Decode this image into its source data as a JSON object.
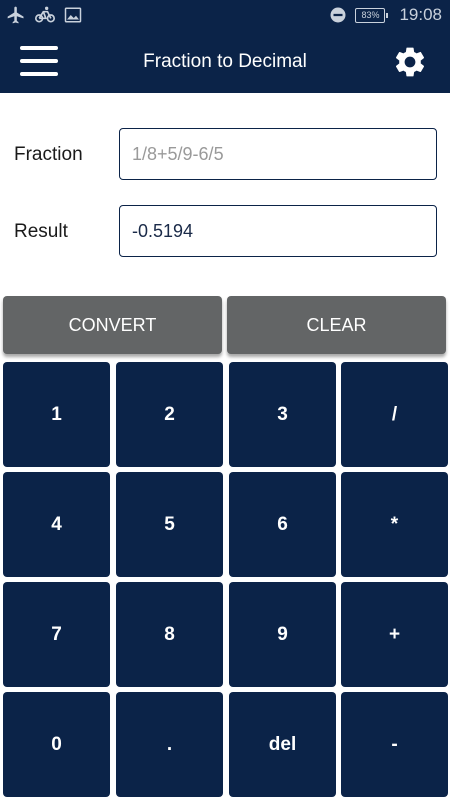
{
  "status_bar": {
    "battery_level": "83%",
    "time": "19:08",
    "icons": [
      "airplane-icon",
      "bicycle-icon",
      "image-icon",
      "do-not-disturb-icon",
      "battery-icon"
    ]
  },
  "app_bar": {
    "title": "Fraction to Decimal",
    "menu_icon": "hamburger-menu-icon",
    "settings_icon": "gear-icon"
  },
  "form": {
    "fraction": {
      "label": "Fraction",
      "value": "",
      "placeholder": "1/8+5/9-6/5"
    },
    "result": {
      "label": "Result",
      "value": "-0.5194"
    }
  },
  "actions": {
    "convert_label": "CONVERT",
    "clear_label": "CLEAR"
  },
  "keypad": {
    "rows": [
      [
        "1",
        "2",
        "3",
        "/"
      ],
      [
        "4",
        "5",
        "6",
        "*"
      ],
      [
        "7",
        "8",
        "9",
        "+"
      ],
      [
        "0",
        ".",
        "del",
        "-"
      ]
    ]
  },
  "colors": {
    "primary": "#0b2348",
    "action_gray": "#636566",
    "placeholder_gray": "#9a9a9a"
  }
}
